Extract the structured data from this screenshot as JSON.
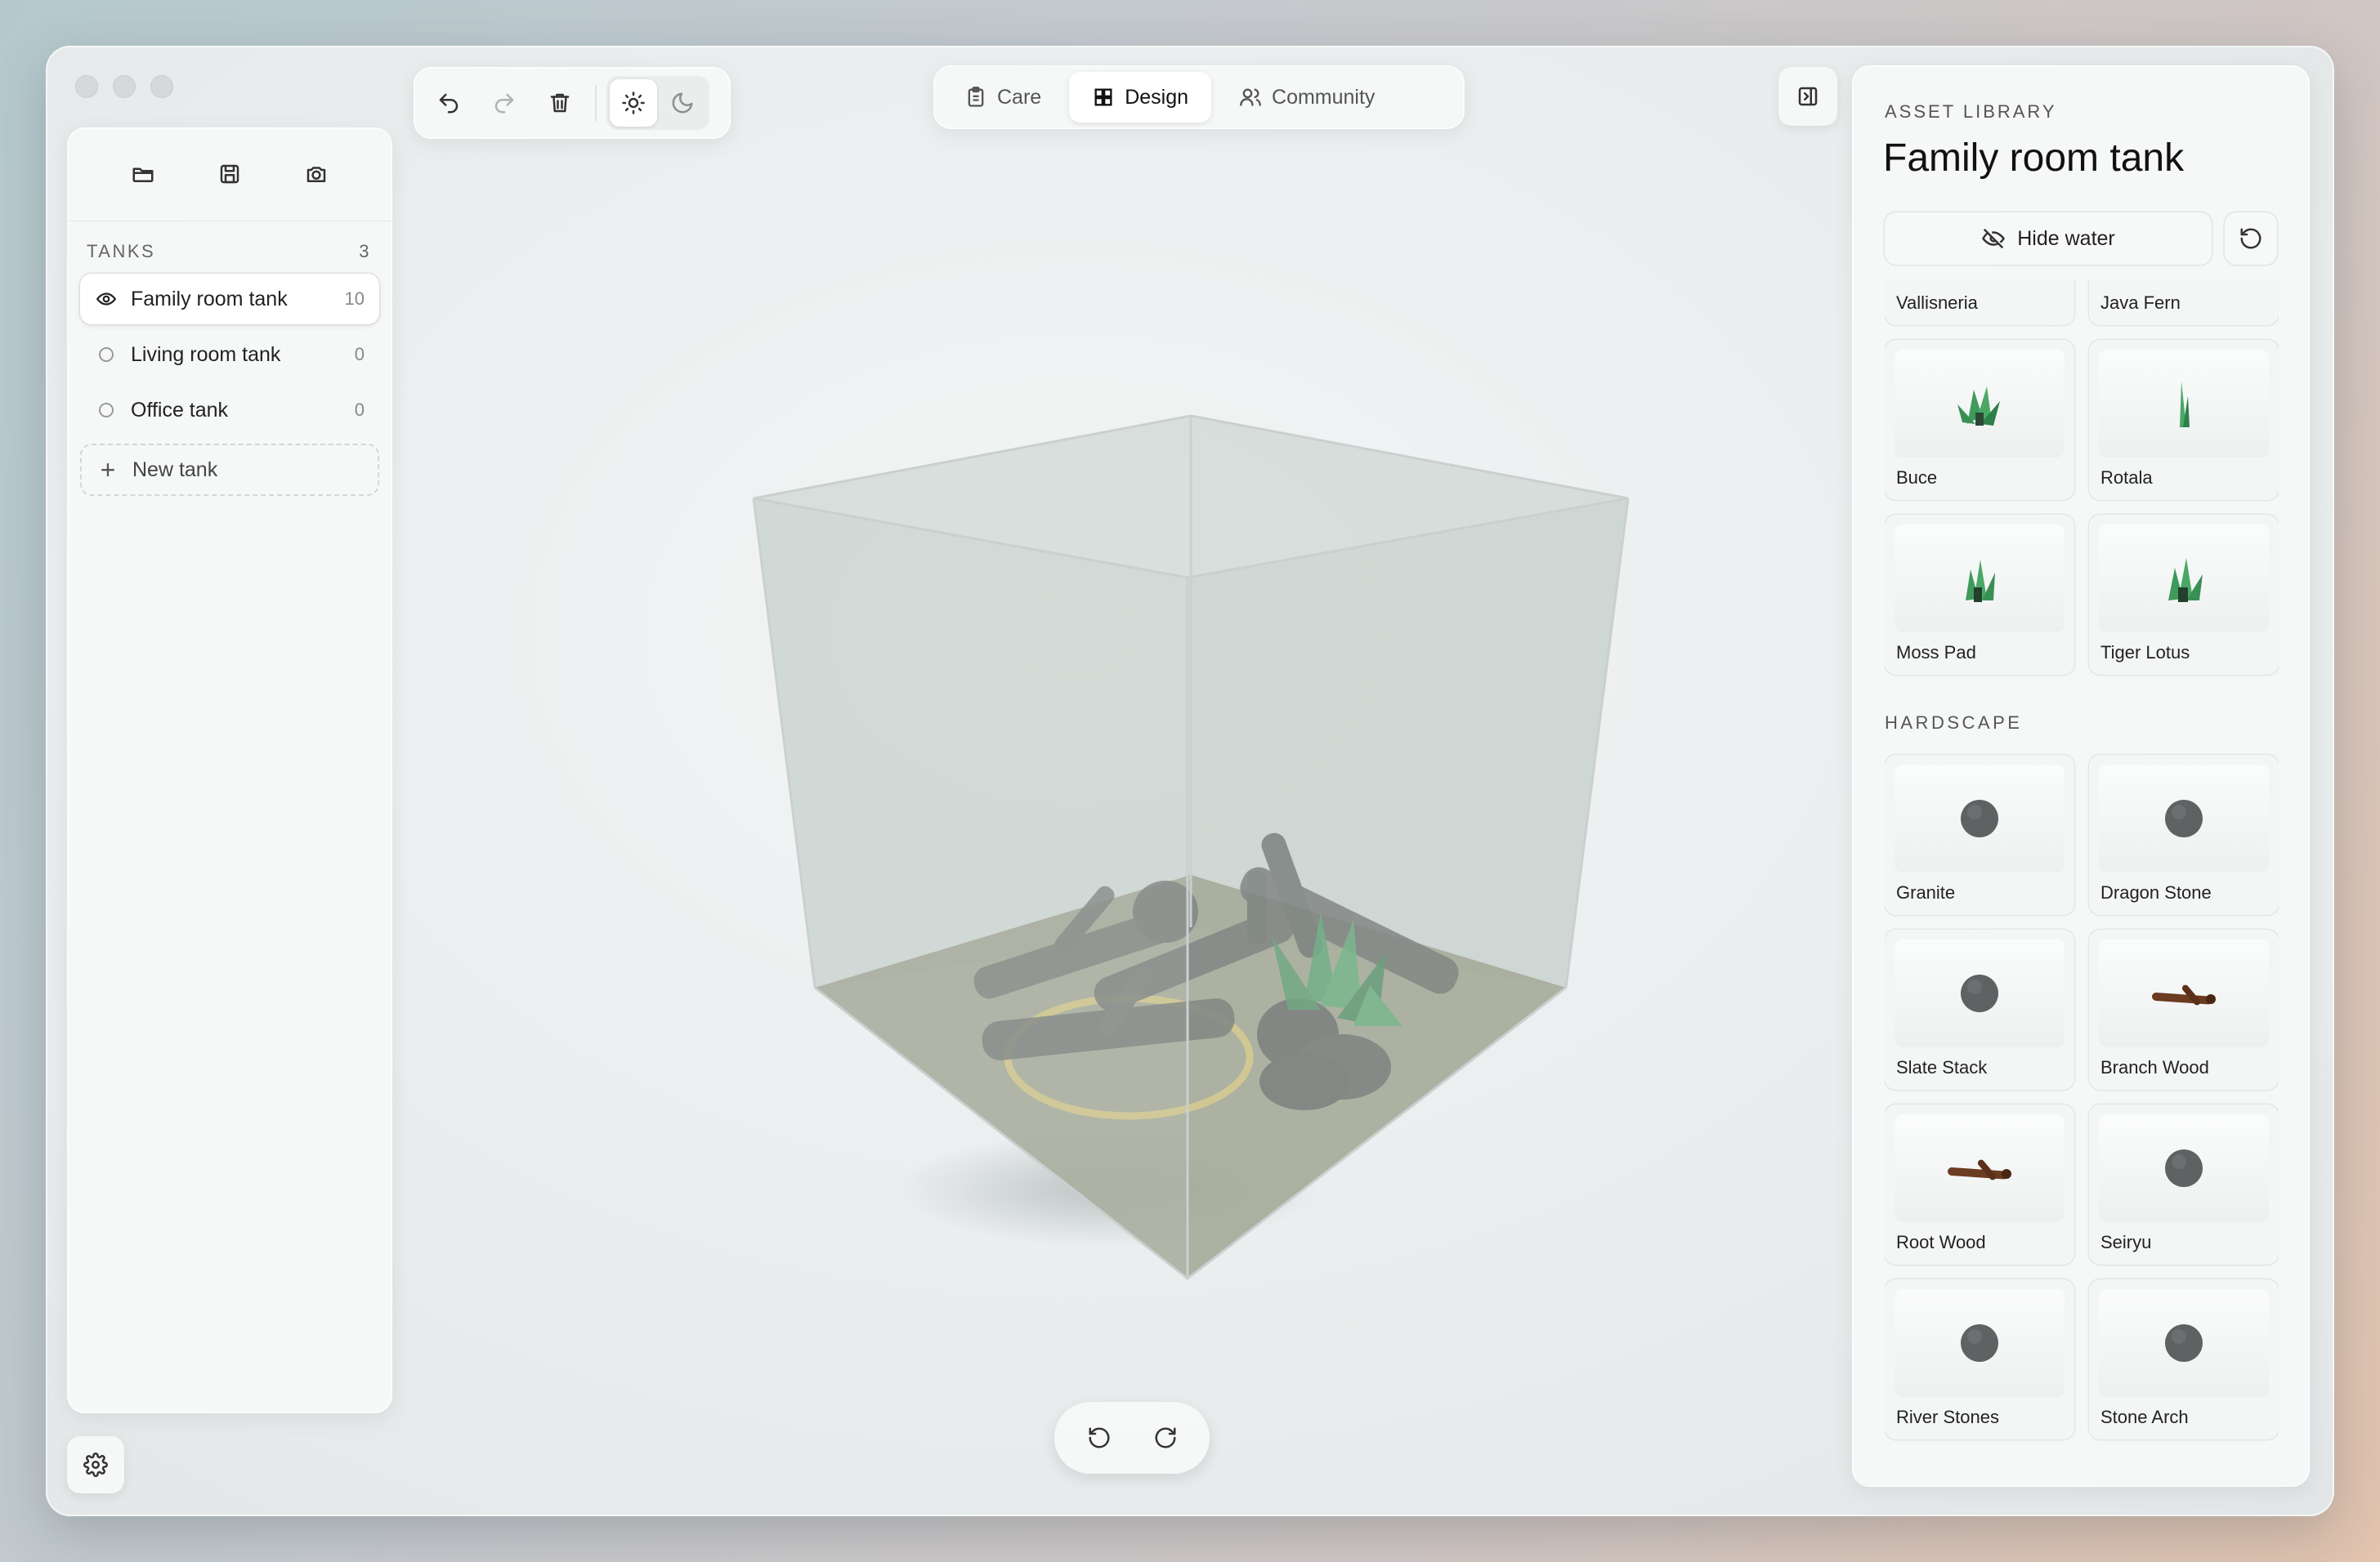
{
  "window": {
    "controls": [
      "close",
      "minimize",
      "maximize"
    ]
  },
  "sidebar": {
    "tools": [
      {
        "name": "open-folder-icon"
      },
      {
        "name": "save-icon"
      },
      {
        "name": "camera-icon"
      }
    ],
    "tanks_heading": "TANKS",
    "tanks_count": "3",
    "tanks": [
      {
        "name": "Family room tank",
        "count": "10",
        "active": true
      },
      {
        "name": "Living room tank",
        "count": "0",
        "active": false
      },
      {
        "name": "Office tank",
        "count": "0",
        "active": false
      }
    ],
    "new_tank_label": "New tank"
  },
  "toolbar": {
    "undo_icon": "undo-icon",
    "redo_icon": "redo-icon",
    "delete_icon": "trash-icon",
    "theme": {
      "selected": "light",
      "options": [
        "light",
        "dark"
      ]
    }
  },
  "tabs": [
    {
      "label": "Care",
      "icon": "clipboard-icon",
      "active": false
    },
    {
      "label": "Design",
      "icon": "grid-icon",
      "active": true
    },
    {
      "label": "Community",
      "icon": "users-icon",
      "active": false
    }
  ],
  "asset_library": {
    "kicker": "ASSET LIBRARY",
    "title": "Family room tank",
    "hide_water_label": "Hide water",
    "plants": [
      {
        "label": "Vallisneria",
        "icon": "plant-icon"
      },
      {
        "label": "Java Fern",
        "icon": "plant-icon"
      },
      {
        "label": "Buce",
        "icon": "plant-icon"
      },
      {
        "label": "Rotala",
        "icon": "stem-plant-icon"
      },
      {
        "label": "Moss Pad",
        "icon": "plant-icon"
      },
      {
        "label": "Tiger Lotus",
        "icon": "plant-icon"
      }
    ],
    "hardscape_heading": "HARDSCAPE",
    "hardscape": [
      {
        "label": "Granite",
        "icon": "stone-icon"
      },
      {
        "label": "Dragon Stone",
        "icon": "stone-icon"
      },
      {
        "label": "Slate Stack",
        "icon": "stone-icon"
      },
      {
        "label": "Branch Wood",
        "icon": "wood-icon"
      },
      {
        "label": "Root Wood",
        "icon": "wood-icon"
      },
      {
        "label": "Seiryu",
        "icon": "stone-icon"
      },
      {
        "label": "River Stones",
        "icon": "stone-icon"
      },
      {
        "label": "Stone Arch",
        "icon": "stone-icon"
      }
    ]
  },
  "colors": {
    "plant_green": "#3f9a5c",
    "stone_gray": "#5f6163",
    "wood_brown": "#6b3b22",
    "selection_ring": "#e3c96a"
  }
}
